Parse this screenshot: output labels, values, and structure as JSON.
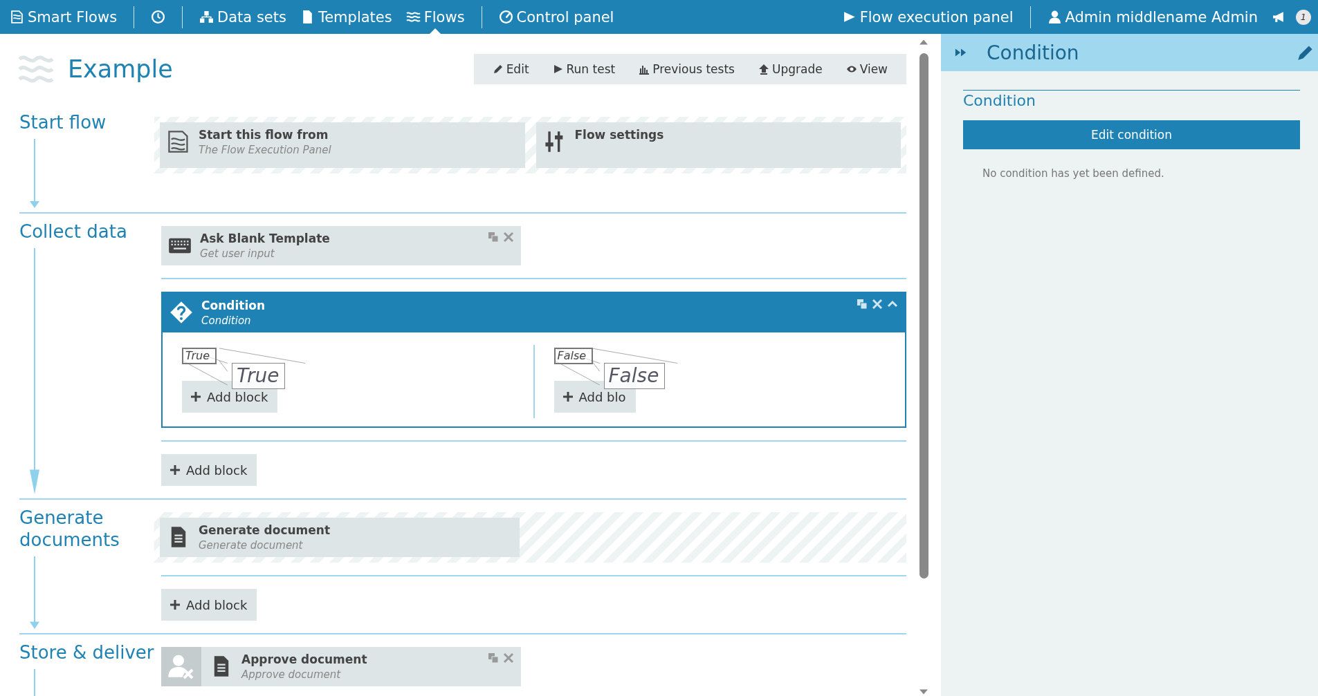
{
  "nav": {
    "brand": "Smart Flows",
    "items": [
      {
        "kind": "history",
        "selected": false
      },
      {
        "kind": "datasets",
        "label": "Data sets",
        "selected": false
      },
      {
        "kind": "templates",
        "label": "Templates",
        "selected": false
      },
      {
        "kind": "flows",
        "label": "Flows",
        "selected": true
      },
      {
        "kind": "control",
        "label": "Control panel",
        "selected": false
      }
    ],
    "execution": "Flow execution panel",
    "user": "Admin middlename Admin",
    "badge": "1"
  },
  "page": {
    "title": "Example",
    "toolbar": [
      {
        "kind": "edit",
        "label": "Edit"
      },
      {
        "kind": "run",
        "label": "Run test"
      },
      {
        "kind": "tests",
        "label": "Previous tests"
      },
      {
        "kind": "upgrade",
        "label": "Upgrade"
      },
      {
        "kind": "view",
        "label": "View"
      }
    ]
  },
  "sections": [
    {
      "title": "Start flow",
      "rows": [
        {
          "kind": "hatched",
          "blocks": [
            {
              "kind": "source",
              "title": "Start this flow from",
              "subtitle": "The Flow Execution Panel",
              "actions": false
            },
            {
              "kind": "settings",
              "title": "Flow settings",
              "actions": false
            }
          ]
        }
      ]
    },
    {
      "title": "Collect data",
      "rows": [
        {
          "kind": "plain",
          "blocks": [
            {
              "kind": "input",
              "title": "Ask Blank Template",
              "subtitle": "Get user input",
              "actions": true
            }
          ]
        },
        {
          "kind": "condition",
          "title": "Condition",
          "subtitle": "Condition",
          "expanded": true,
          "branches": [
            {
              "tag": "True",
              "callout": "True",
              "add": "Add block"
            },
            {
              "tag": "False",
              "callout": "False",
              "add": "Add blo"
            }
          ]
        },
        {
          "kind": "add",
          "label": "Add block"
        }
      ]
    },
    {
      "title": "Generate documents",
      "rows": [
        {
          "kind": "hatched",
          "blocks": [
            {
              "kind": "document",
              "title": "Generate document",
              "subtitle": "Generate document",
              "actions": false
            }
          ]
        },
        {
          "kind": "add",
          "label": "Add block"
        }
      ]
    },
    {
      "title": "Store & deliver",
      "rows": [
        {
          "kind": "plain",
          "blocks": [
            {
              "kind": "approval",
              "title": "Approve document",
              "subtitle": "Approve document",
              "actions": true
            }
          ]
        }
      ]
    }
  ],
  "panel": {
    "title": "Condition",
    "heading": "Condition",
    "button": "Edit condition",
    "message": "No condition has yet been defined."
  }
}
